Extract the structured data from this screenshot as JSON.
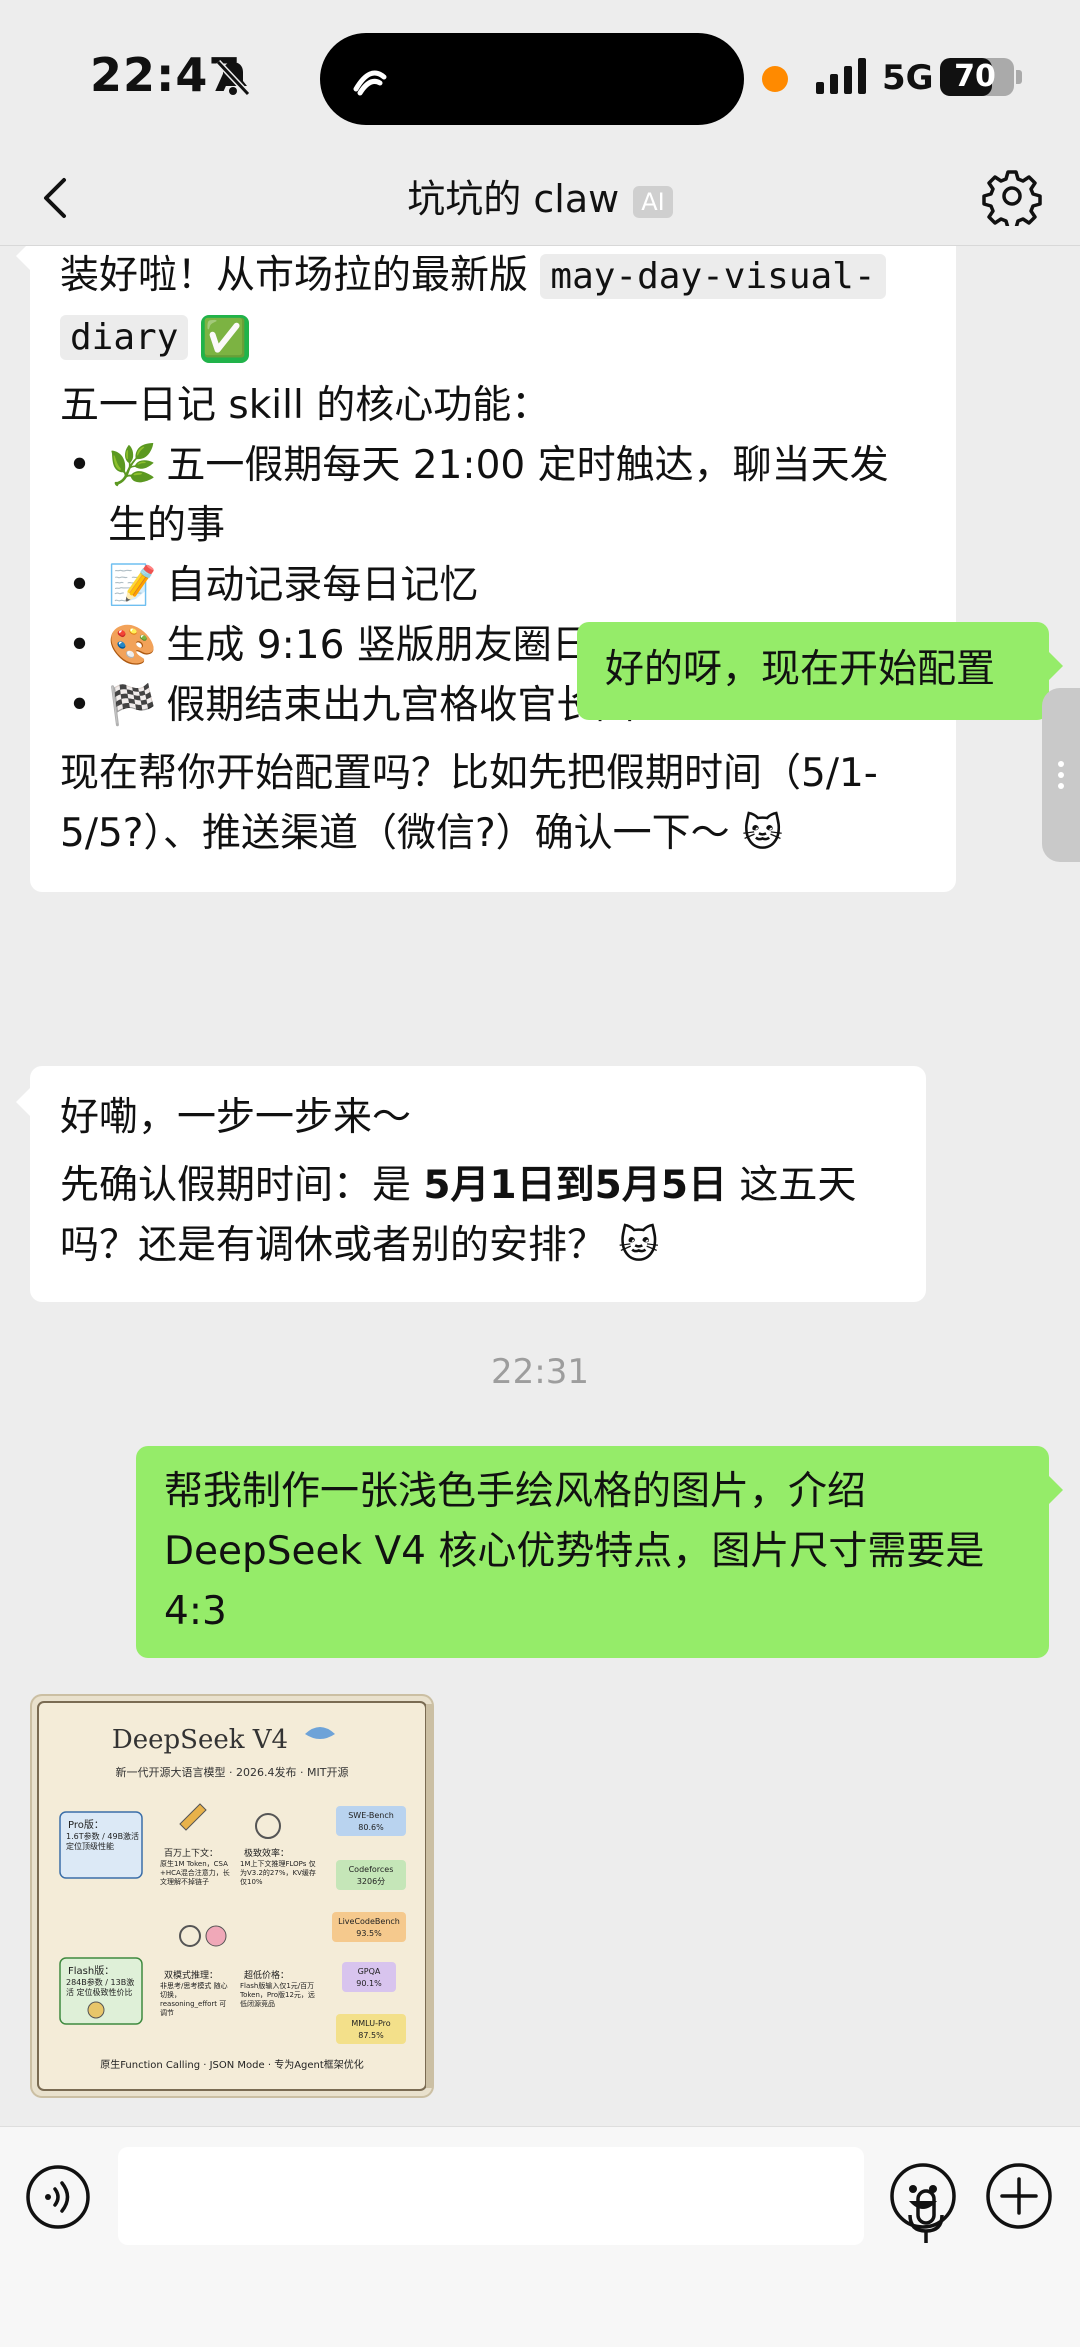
{
  "status": {
    "time": "22:47",
    "network": "5G",
    "battery": "70",
    "battery_level": 0.7
  },
  "header": {
    "title": "坑坑的 claw",
    "ai_badge": "AI"
  },
  "messages": {
    "m1": {
      "intro": "装好啦！从市场拉的最新版 ",
      "code1": "may-day-visual-",
      "code2": "diary",
      "check": "✅",
      "features_title": "五一日记 skill 的核心功能：",
      "features": [
        {
          "emoji": "🌿",
          "text": "五一假期每天 21:00 定时触达，聊当天发生的事"
        },
        {
          "emoji": "📝",
          "text": "自动记录每日记忆"
        },
        {
          "emoji": "🎨",
          "text": "生成 9:16 竖版朋友圈日记图"
        },
        {
          "emoji": "🏁",
          "text": "假期结束出九宫格收官长图"
        }
      ],
      "outro": "现在帮你开始配置吗？比如先把假期时间（5/1-5/5?）、推送渠道（微信?）确认一下～ 🐱"
    },
    "m2": {
      "text": "好的呀，现在开始配置"
    },
    "m3": {
      "line1": "好嘞，一步一步来～",
      "pre": "先确认假期时间：是 ",
      "bold": "5月1日到5月5日",
      "post": " 这五天吗？还是有调休或者别的安排？ 🐱"
    },
    "timestamp": "22:31",
    "m4": {
      "text": "帮我制作一张浅色手绘风格的图片，介绍 DeepSeek V4 核心优势特点，图片尺寸需要是 4:3"
    },
    "image": {
      "title": "DeepSeek V4",
      "subtitle": "新一代开源大语言模型 · 2026.4发布 · MIT开源",
      "pro_title": "Pro版：",
      "pro_text": "1.6T参数 / 49B激活 定位顶级性能",
      "flash_title": "Flash版：",
      "flash_text": "284B参数 / 13B激活 定位极致性价比",
      "f1_title": "百万上下文：",
      "f1_text": "原生1M Token，CSA +HCA混合注意力，长文理解不掉链子",
      "f2_title": "极致效率：",
      "f2_text": "1M上下文推理FLOPs 仅为V3.2的27%，KV缓存仅10%",
      "f3_title": "双模式推理：",
      "f3_text": "非思考/思考模式 随心切换，reasoning_effort 可调节",
      "f4_title": "超低价格：",
      "f4_text": "Flash版输入仅1元/百万Token，Pro版12元，远低闭源竞品",
      "bench": [
        {
          "name": "SWE-Bench",
          "value": "80.6%"
        },
        {
          "name": "Codeforces",
          "value": "3206分"
        },
        {
          "name": "LiveCodeBench",
          "value": "93.5%"
        },
        {
          "name": "GPQA",
          "value": "90.1%"
        },
        {
          "name": "MMLU-Pro",
          "value": "87.5%"
        }
      ],
      "footer": "原生Function Calling · JSON Mode · 专为Agent框架优化"
    }
  }
}
